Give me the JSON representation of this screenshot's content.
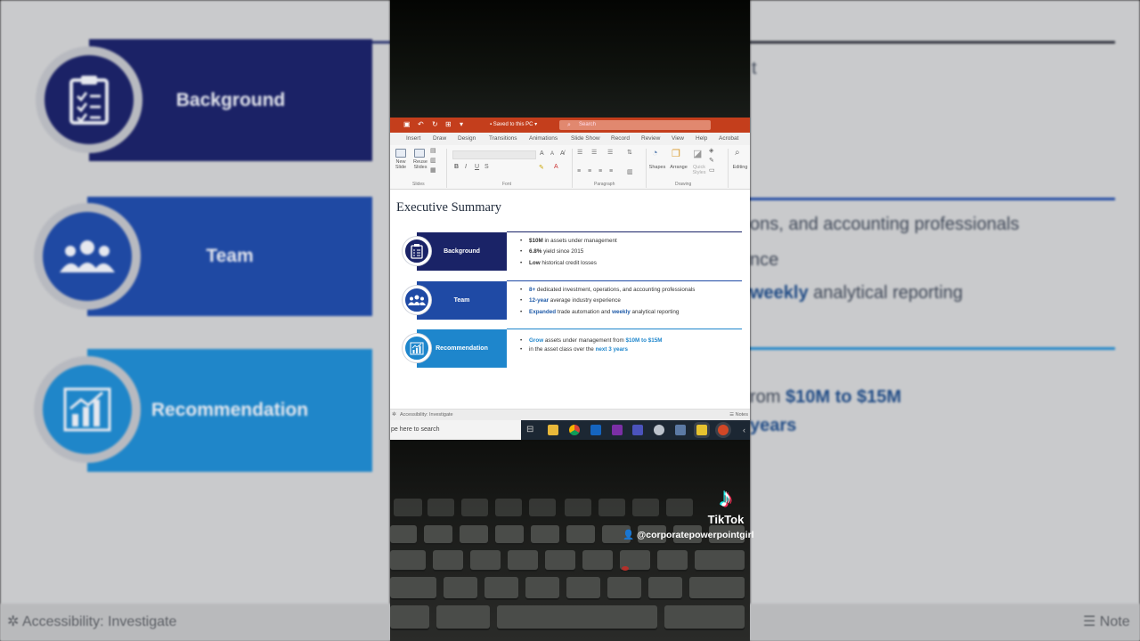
{
  "slide": {
    "title": "Executive Summary",
    "rows": [
      {
        "label": "Background",
        "icon": "clipboard-icon",
        "band_color": "#1a2367",
        "circle_color": "#1a2367",
        "bullets": [
          {
            "bold": "$10M",
            "text": " in assets under management"
          },
          {
            "bold": "6.8%",
            "text": " yield since 2015"
          },
          {
            "bold": "Low",
            "text": " historical credit losses"
          }
        ]
      },
      {
        "label": "Team",
        "icon": "team-icon",
        "band_color": "#1f4aa5",
        "circle_color": "#1f4aa5",
        "bullets": [
          {
            "bold": "8+",
            "text": " dedicated investment, operations, and accounting professionals"
          },
          {
            "bold": "12-year",
            "text": " average industry experience"
          },
          {
            "bold": "Expanded",
            "text": " trade automation and ",
            "bold2": "weekly",
            "text2": " analytical reporting"
          }
        ]
      },
      {
        "label": "Recommendation",
        "icon": "bar-chart-icon",
        "band_color": "#1e86cc",
        "circle_color": "#1e86cc",
        "bullets": [
          {
            "bold": "Grow",
            "text": " assets under management from ",
            "bold2": "$10M to $15M",
            "text2": ""
          },
          {
            "bold": "",
            "text": "in the asset class over the ",
            "bold2": "next 3 years",
            "text2": ""
          }
        ]
      }
    ]
  },
  "titlebar": {
    "doc_status": "▪ Saved to this PC ▾",
    "search_placeholder": "Search"
  },
  "ribbon_tabs": [
    "Insert",
    "Draw",
    "Design",
    "Transitions",
    "Animations",
    "Slide Show",
    "Record",
    "Review",
    "View",
    "Help",
    "Acrobat"
  ],
  "ribbon": {
    "new_slide": "New\nSlide",
    "reuse_slides": "Reuse\nSlides",
    "group_slides": "Slides",
    "group_font": "Font",
    "group_paragraph": "Paragraph",
    "group_drawing": "Drawing",
    "shapes": "Shapes",
    "arrange": "Arrange",
    "quick_styles": "Quick\nStyles",
    "editing": "Editing"
  },
  "statusbar": {
    "accessibility": "Accessibility: Investigate",
    "notes": "Notes"
  },
  "taskbar": {
    "search_placeholder": "pe here to search"
  },
  "bg_left": {
    "labels": [
      "Background",
      "Team",
      "Recommendation"
    ],
    "accessibility": "Accessibility: Investigate"
  },
  "bg_right": {
    "line_1": "t",
    "line_2": "ons, and accounting professionals",
    "line_3": "nce",
    "line_4_bold": "weekly",
    "line_4": " analytical reporting",
    "line_5_pre": "rom ",
    "line_5_bold": "$10M to $15M",
    "line_6_bold": "years",
    "notes": "Note"
  },
  "watermark": {
    "brand": "TikTok",
    "handle": "@corporatepowerpointgirl"
  },
  "colors": {
    "ppt_accent": "#c43e1c",
    "highlight_blue": "#1e5aa8",
    "navy": "#1a2367",
    "royal": "#1f4aa5",
    "sky": "#1e86cc"
  }
}
